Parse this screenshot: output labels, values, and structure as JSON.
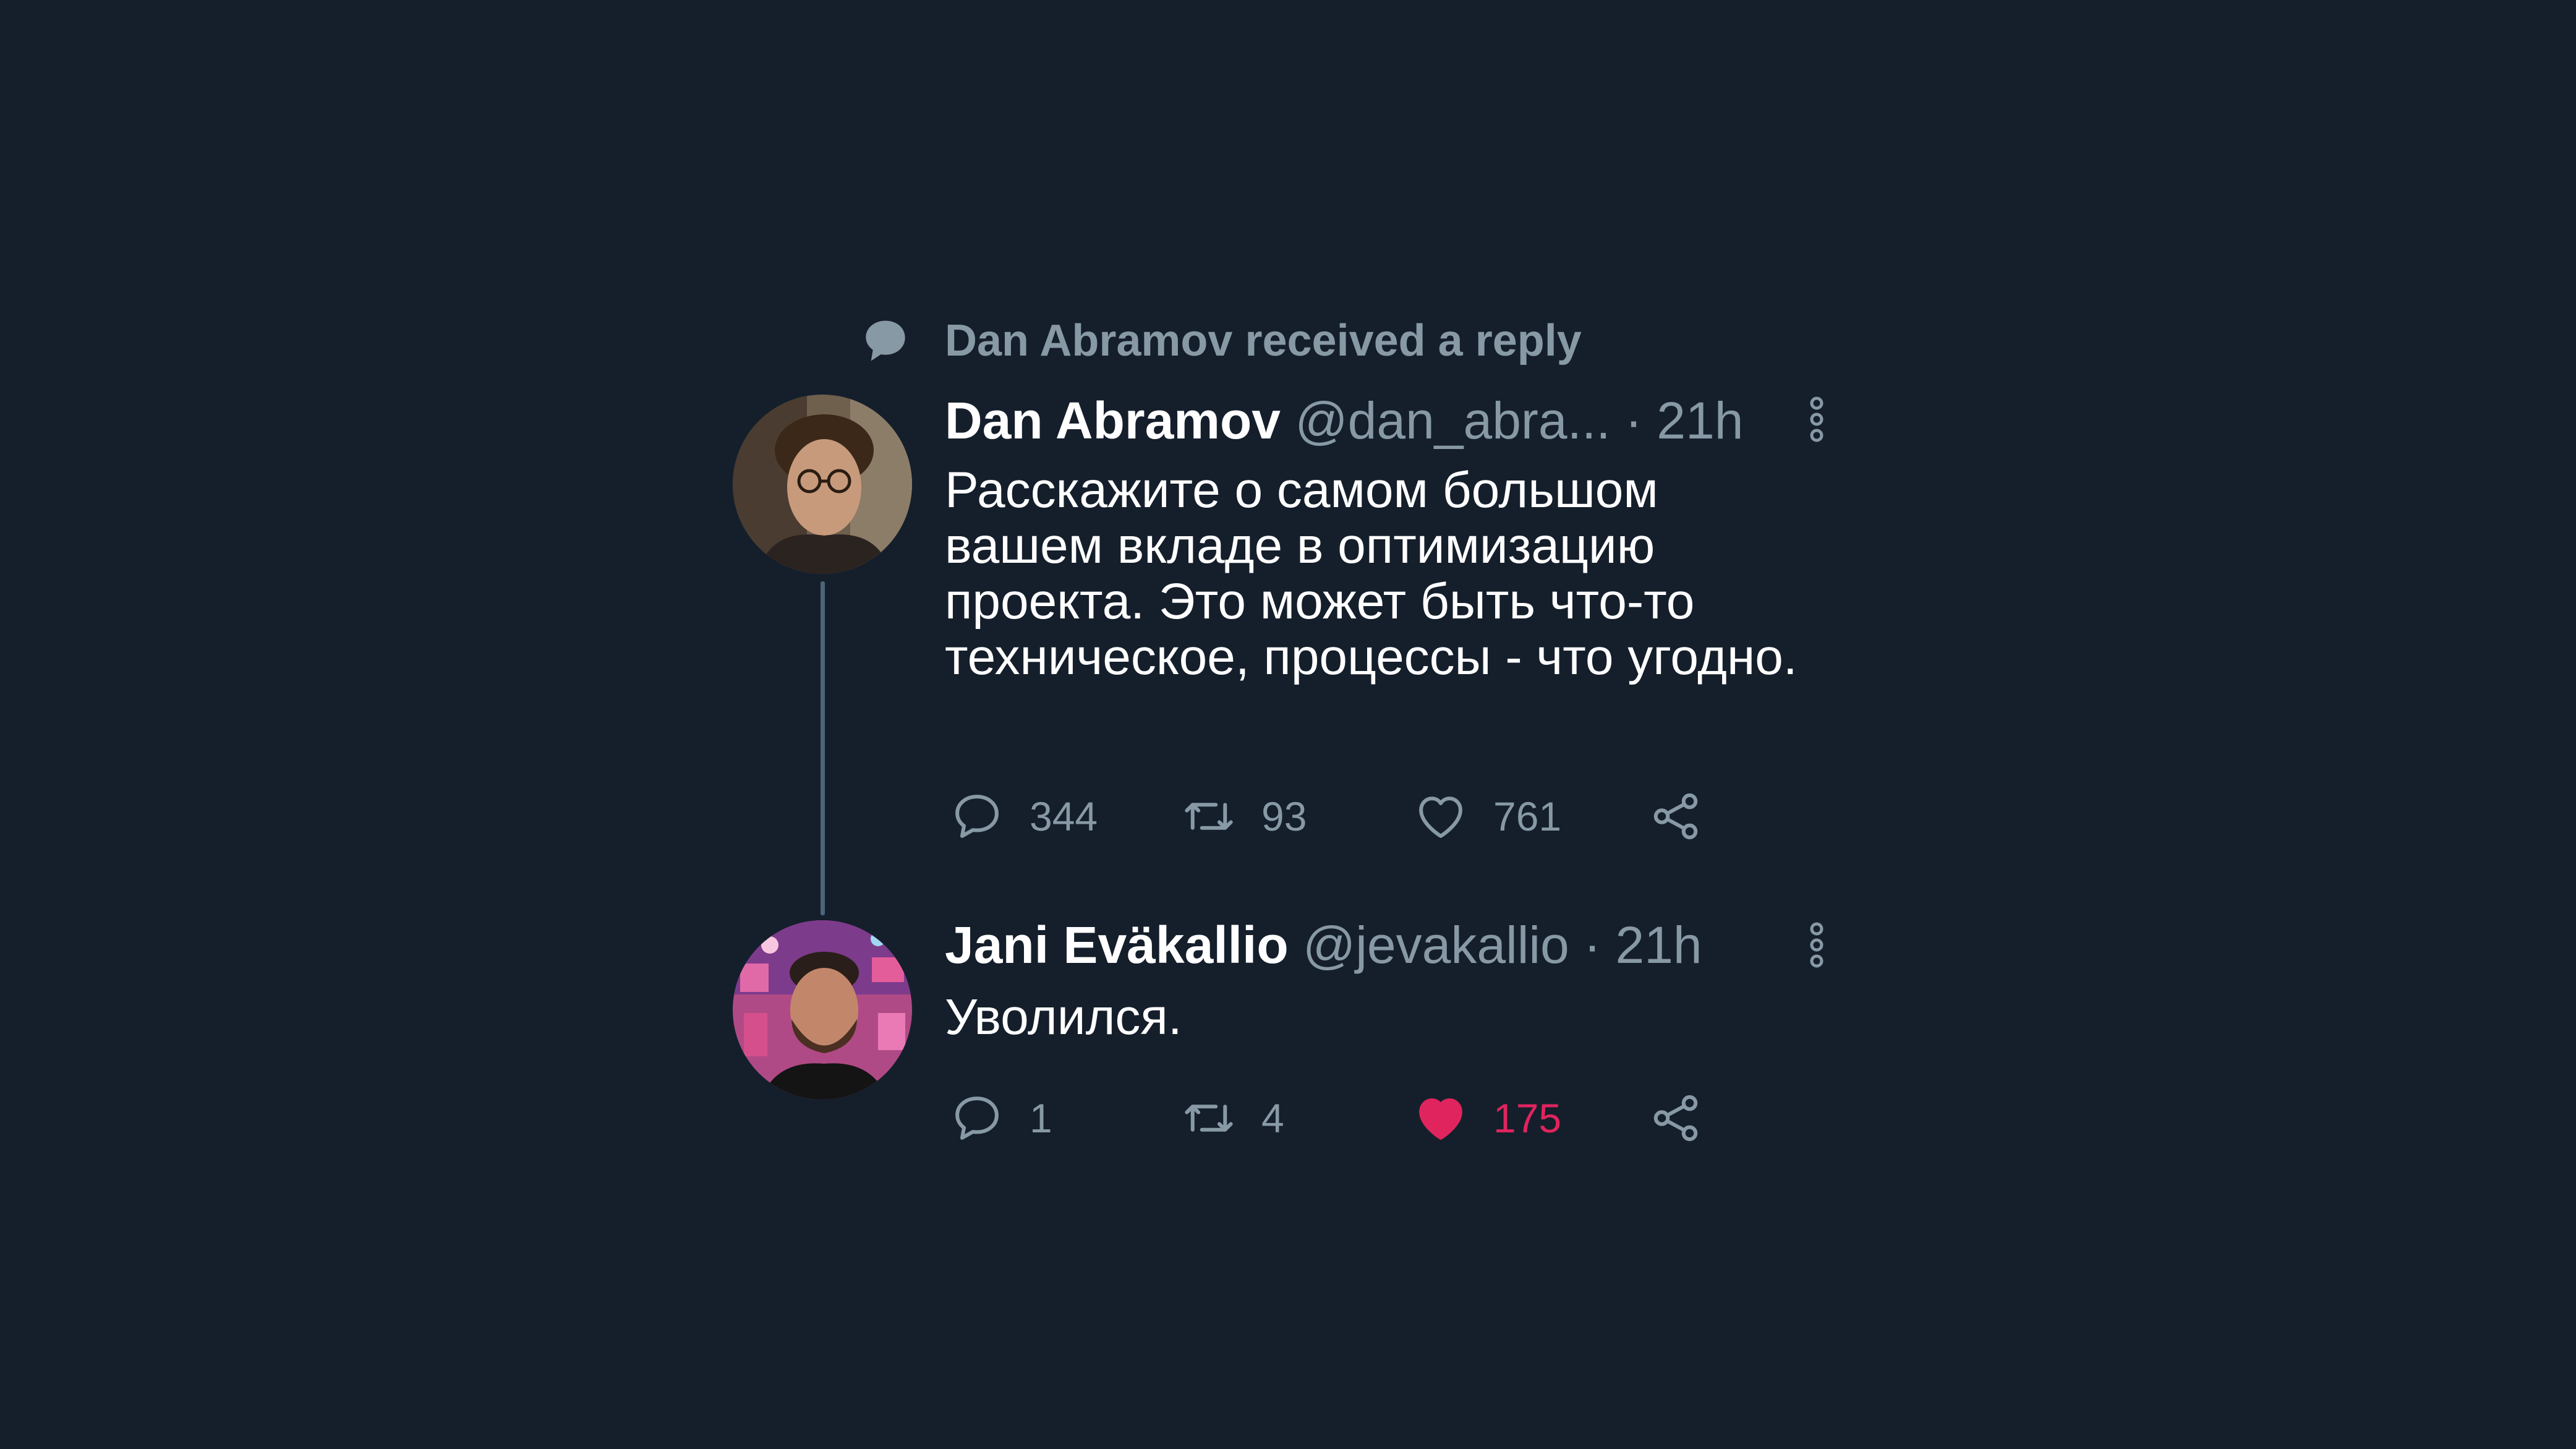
{
  "context": {
    "text": "Dan Abramov received a reply",
    "icon": "speech-bubble-icon"
  },
  "tweets": [
    {
      "author_name": "Dan Abramov",
      "handle": "@dan_abra...",
      "separator": " · ",
      "time": "21h",
      "text": "Расскажите о самом большом вашем вкладе в оптимизацию проекта. Это может быть что-то техническое, процессы - что угодно.",
      "counts": {
        "replies": "344",
        "retweets": "93",
        "likes": "761"
      },
      "liked": false
    },
    {
      "author_name": "Jani Eväkallio",
      "handle": "@jevakallio",
      "separator": " · ",
      "time": "21h",
      "text": "Уволился.",
      "counts": {
        "replies": "1",
        "retweets": "4",
        "likes": "175"
      },
      "liked": true
    }
  ],
  "colors": {
    "background": "#151f2b",
    "muted": "#8899a6",
    "like_active": "#e0245e",
    "text": "#ffffff"
  },
  "icons": {
    "reply": "reply-bubble-icon",
    "retweet": "retweet-icon",
    "like": "heart-icon",
    "share": "share-icon",
    "more": "more-vertical-icon"
  }
}
